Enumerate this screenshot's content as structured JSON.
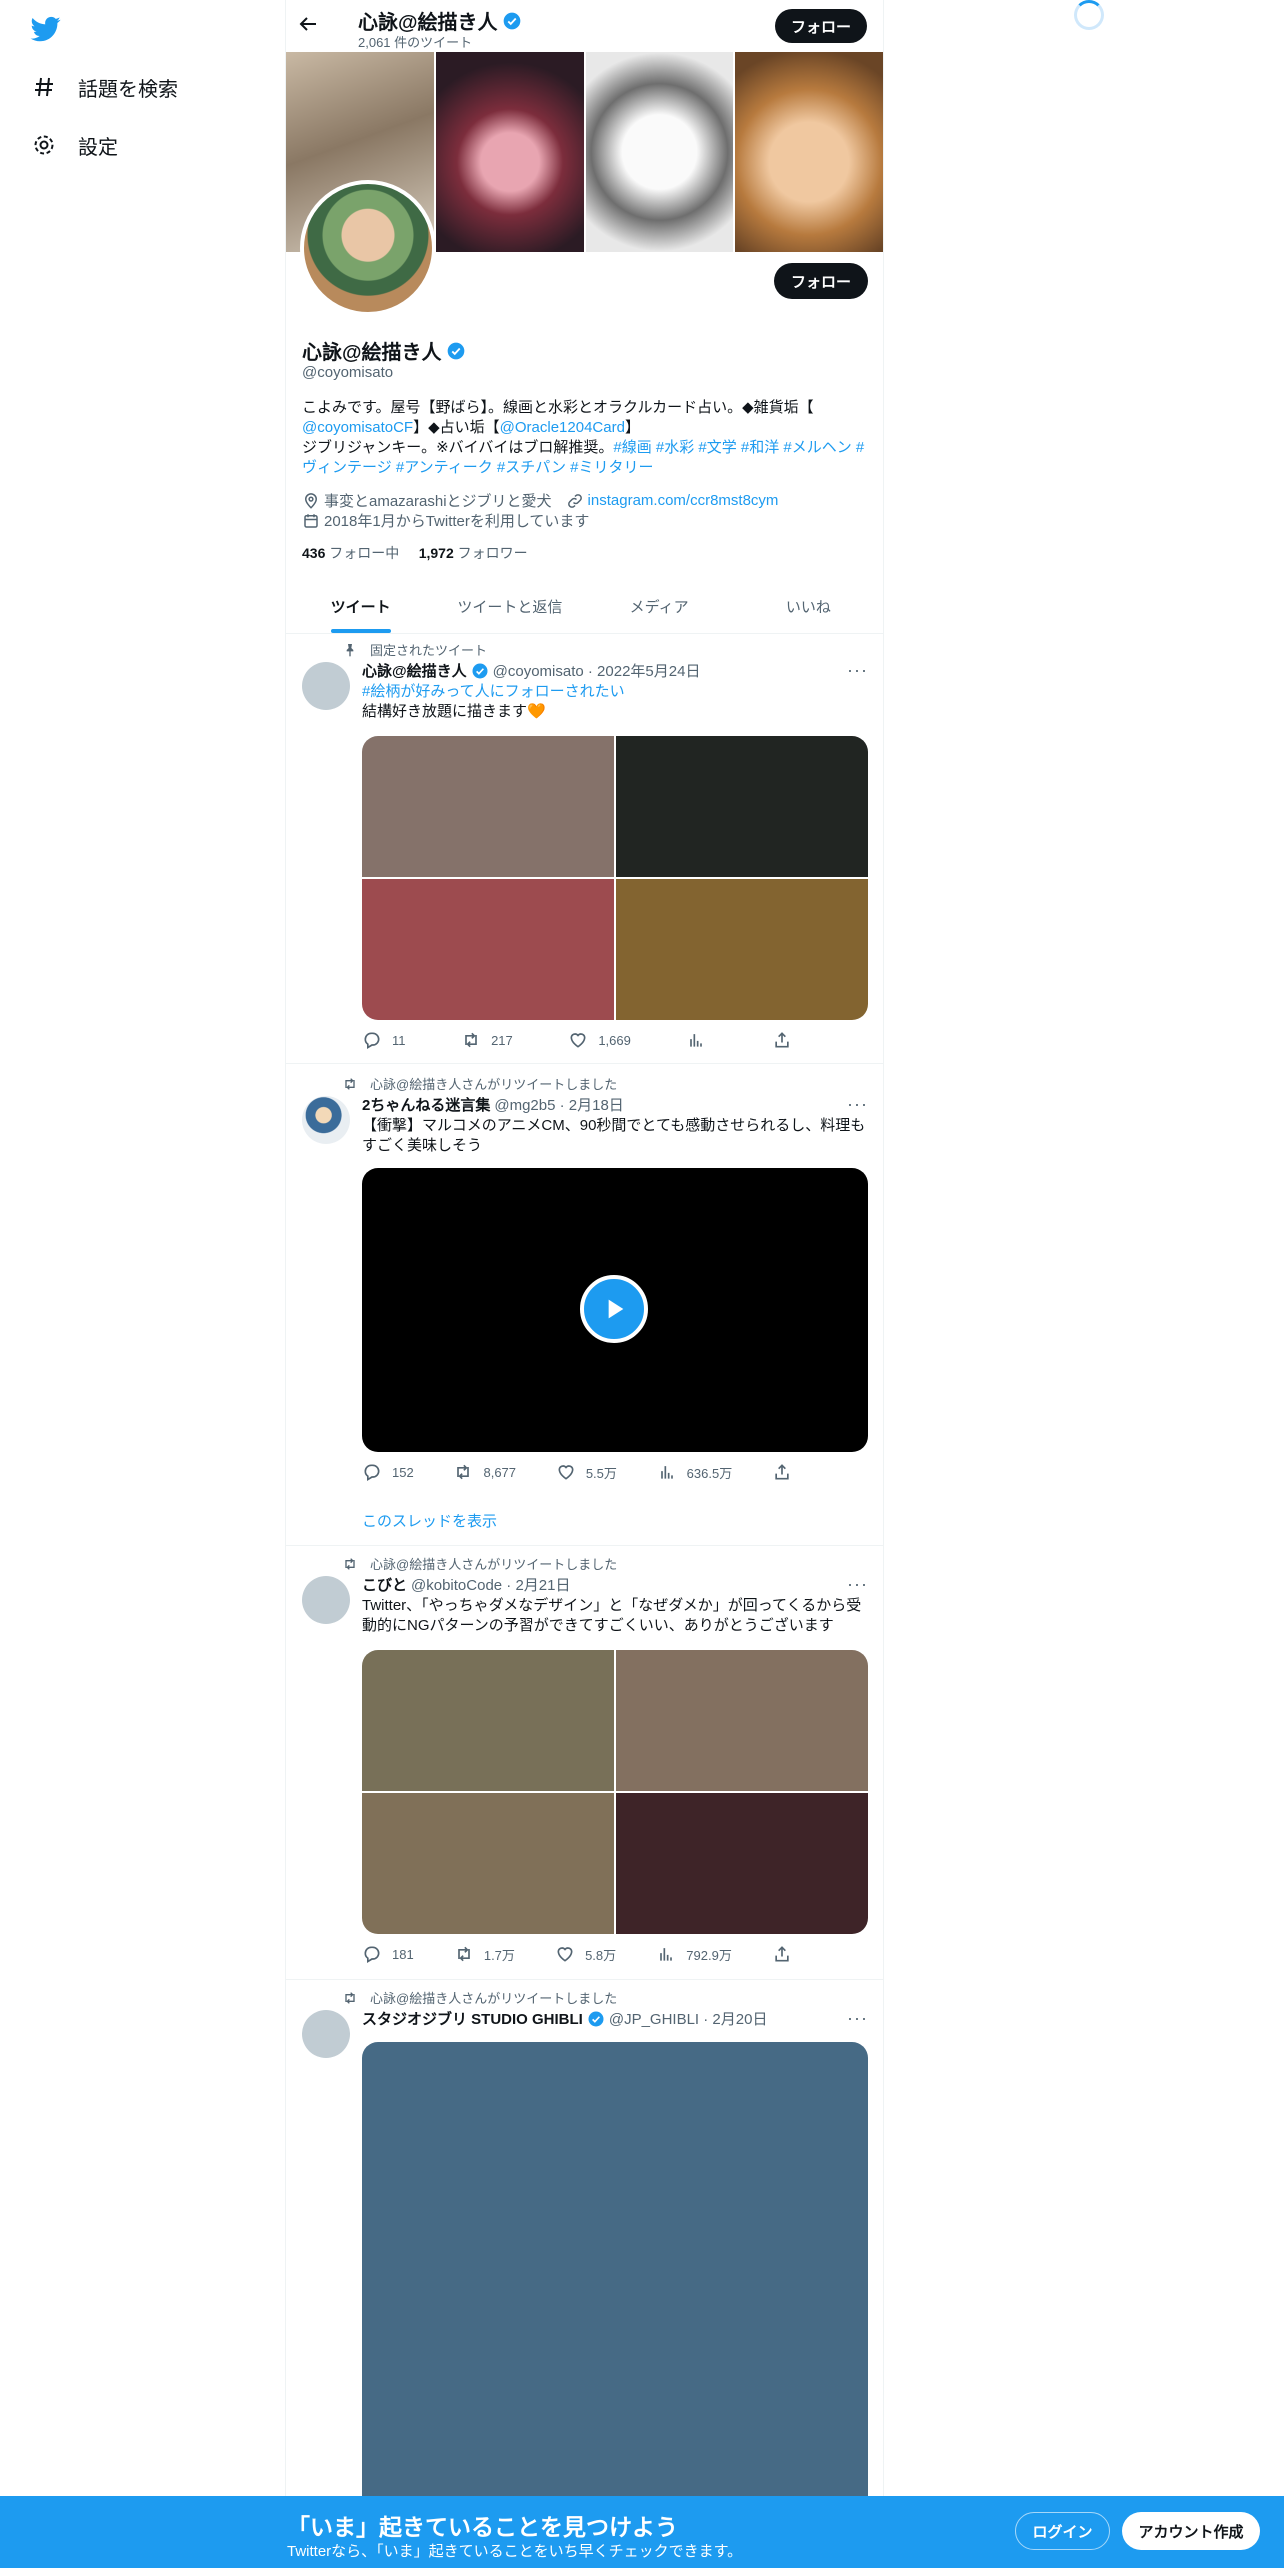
{
  "sidebar": {
    "items": [
      {
        "label": "話題を検索",
        "icon": "hashtag-icon"
      },
      {
        "label": "設定",
        "icon": "gear-icon"
      }
    ]
  },
  "header": {
    "name": "心詠@絵描き人",
    "tweet_count": "2,061 件のツイート",
    "follow_label": "フォロー"
  },
  "profile": {
    "name": "心詠@絵描き人",
    "handle": "@coyomisato",
    "follow_label": "フォロー",
    "bio_line1": "こよみです。屋号【野ばら】。線画と水彩とオラクルカード占い。◆雑貨垢【",
    "bio_link1": "@coyomisatoCF",
    "bio_mid": "】◆占い垢【",
    "bio_link2": "@Oracle1204Card",
    "bio_end": "】",
    "bio_line3": "ジブリジャンキー。※バイバイはブロ解推奨。",
    "bio_tags": "#線画 #水彩 #文学 #和洋 #メルヘン #ヴィンテージ #アンティーク #スチパン #ミリタリー",
    "location": "事変とamazarashiとジブリと愛犬",
    "url": "instagram.com/ccr8mst8cym",
    "joined": "2018年1月からTwitterを利用しています",
    "following_count": "436",
    "following_label": "フォロー中",
    "followers_count": "1,972",
    "followers_label": "フォロワー"
  },
  "tabs": [
    {
      "label": "ツイート"
    },
    {
      "label": "ツイートと返信"
    },
    {
      "label": "メディア"
    },
    {
      "label": "いいね"
    }
  ],
  "tweets": [
    {
      "context": "固定されたツイート",
      "name": "心詠@絵描き人",
      "handle": "@coyomisato · 2022年5月24日",
      "tag": "#絵柄が好みって人にフォローされたい",
      "text": "結構好き放題に描きます🧡",
      "replies": "11",
      "retweets": "217",
      "likes": "1,669",
      "views": ""
    },
    {
      "context": "心詠@絵描き人さんがリツイートしました",
      "name": "2ちゃんねる迷言集",
      "handle": "@mg2b5 · 2月18日",
      "text": "【衝撃】マルコメのアニメCM、90秒間でとても感動させられるし、料理もすごく美味しそう",
      "replies": "152",
      "retweets": "8,677",
      "likes": "5.5万",
      "views": "636.5万",
      "show_thread": "このスレッドを表示"
    },
    {
      "context": "心詠@絵描き人さんがリツイートしました",
      "name": "こびと",
      "handle": "@kobitoCode · 2月21日",
      "text": "Twitter、「やっちゃダメなデザイン」と「なぜダメか」が回ってくるから受動的にNGパターンの予習ができてすごくいい、ありがとうございます",
      "replies": "181",
      "retweets": "1.7万",
      "likes": "5.8万",
      "views": "792.9万"
    },
    {
      "context": "心詠@絵描き人さんがリツイートしました",
      "name": "スタジオジブリ STUDIO GHIBLI",
      "handle": "@JP_GHIBLI · 2月20日"
    }
  ],
  "bottom_bar": {
    "title": "「いま」起きていることを見つけよう",
    "subtitle": "Twitterなら、「いま」起きていることをいち早くチェックできます。",
    "login": "ログイン",
    "signup": "アカウント作成"
  },
  "colors": {
    "accent": "#1d9bf0",
    "text": "#0f1419",
    "muted": "#536471"
  }
}
